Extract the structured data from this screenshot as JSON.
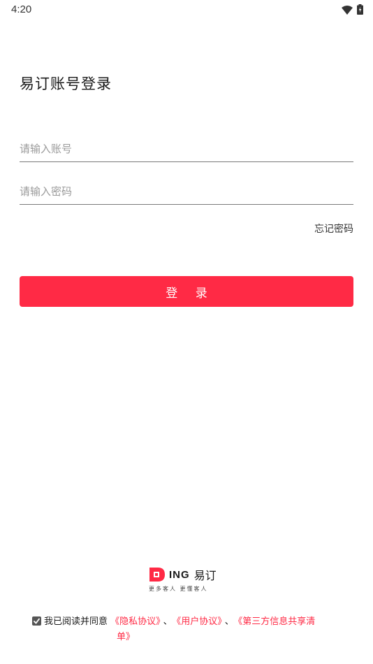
{
  "status_bar": {
    "time": "4:20"
  },
  "login": {
    "title": "易订账号登录",
    "account_placeholder": "请输入账号",
    "password_placeholder": "请输入密码",
    "forgot_label": "忘记密码",
    "login_button": "登 录"
  },
  "brand": {
    "logo_text": "ING",
    "name": "易订",
    "slogan": "更多客人 更懂客人"
  },
  "agreement": {
    "checked": true,
    "prefix": "我已阅读并同意",
    "privacy": "《隐私协议》",
    "sep1": "、",
    "user": "《用户协议》",
    "sep2": "、",
    "third_party_a": "《第三方信息共享清",
    "third_party_b": "单》"
  },
  "colors": {
    "accent": "#ff2a45"
  }
}
